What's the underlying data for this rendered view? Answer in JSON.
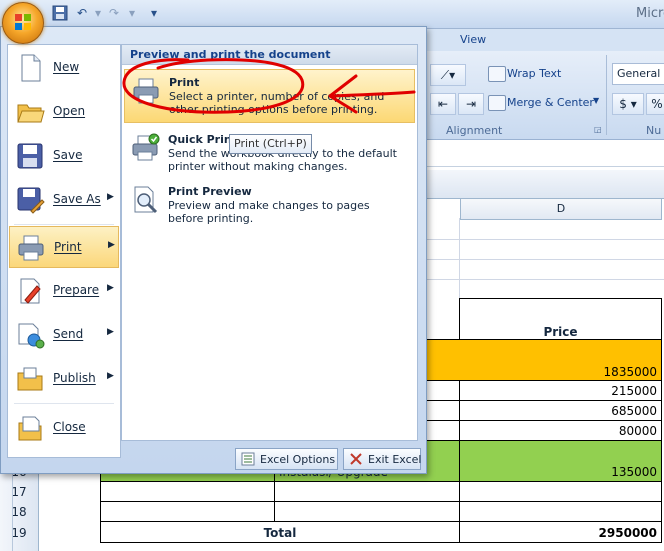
{
  "window": {
    "title": "Micro"
  },
  "quick_access": {
    "save_icon": "save-icon",
    "undo_icon": "undo-icon",
    "redo_icon": "redo-icon",
    "customize_icon": "customize-qat-icon"
  },
  "ribbon": {
    "tab_view": "View",
    "wrap_text": "Wrap Text",
    "merge_center": "Merge & Center",
    "alignment_label": "Alignment",
    "number_format": "General",
    "currency_symbol": "$",
    "percent_symbol": "%",
    "number_label_partial": "Nu"
  },
  "office_menu": {
    "items": [
      {
        "label": "New"
      },
      {
        "label": "Open"
      },
      {
        "label": "Save"
      },
      {
        "label": "Save As"
      },
      {
        "label": "Print"
      },
      {
        "label": "Prepare"
      },
      {
        "label": "Send"
      },
      {
        "label": "Publish"
      },
      {
        "label": "Close"
      }
    ],
    "submenu": {
      "heading": "Preview and print the document",
      "items": [
        {
          "title": "Print",
          "description": "Select a printer, number of copies, and other printing options before printing."
        },
        {
          "title": "Quick Print",
          "description": "Send the workbook directly to the default printer without making changes."
        },
        {
          "title": "Print Preview",
          "description": "Preview and make changes to pages before printing."
        }
      ]
    },
    "tooltip": "Print (Ctrl+P)",
    "excel_options": "Excel Options",
    "exit_excel": "Exit Excel"
  },
  "sheet": {
    "column_d": "D",
    "price_header": "Price",
    "prices": [
      "1835000",
      "215000",
      "685000",
      "80000",
      "135000"
    ],
    "partial_text": "Instalasi/ Upgrade",
    "row_numbers": [
      "16",
      "17",
      "18",
      "19"
    ],
    "total_label": "Total",
    "total_value": "2950000",
    "colors": {
      "orange_fill": "#ffc000",
      "green_fill": "#92d050"
    }
  },
  "annotation": {
    "color": "#e00000"
  }
}
